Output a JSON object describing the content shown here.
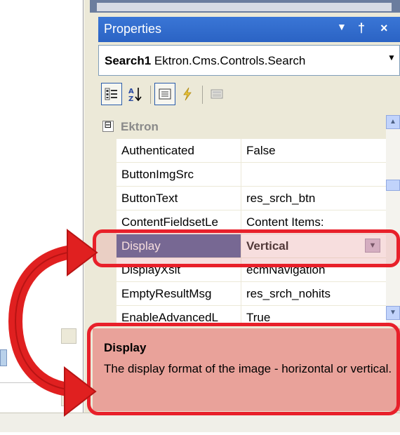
{
  "panel": {
    "title": "Properties",
    "pin_glyph": "↓ ↑",
    "close_glyph": "×"
  },
  "object_selector": {
    "name": "Search1",
    "type": "Ektron.Cms.Controls.Search"
  },
  "toolbar": {
    "buttons": [
      {
        "icon": "categorized-icon",
        "pressed": true
      },
      {
        "icon": "alphabetical-icon",
        "pressed": false
      },
      {
        "icon": "properties-icon",
        "pressed": true
      },
      {
        "icon": "events-icon",
        "pressed": false
      },
      {
        "icon": "property-pages-icon",
        "pressed": false
      }
    ]
  },
  "grid": {
    "category": {
      "toggle": "⊟",
      "label": "Ektron"
    },
    "rows": [
      {
        "name": "Authenticated",
        "value": "False"
      },
      {
        "name": "ButtonImgSrc",
        "value": ""
      },
      {
        "name": "ButtonText",
        "value": "res_srch_btn"
      },
      {
        "name": "ContentFieldsetLe",
        "value": "Content Items:"
      },
      {
        "name": "Display",
        "value": "Vertical",
        "selected": true
      },
      {
        "name": "DisplayXslt",
        "value": "ecmNavigation"
      },
      {
        "name": "EmptyResultMsg",
        "value": "res_srch_nohits"
      },
      {
        "name": "EnableAdvancedL",
        "value": "True"
      }
    ]
  },
  "description": {
    "title": "Display",
    "text": "The display format of the image - horizontal or vertical."
  },
  "colors": {
    "highlight": "#e8202a",
    "selected_row": "#3b4a8c",
    "desc_bg": "#e9a29a"
  }
}
